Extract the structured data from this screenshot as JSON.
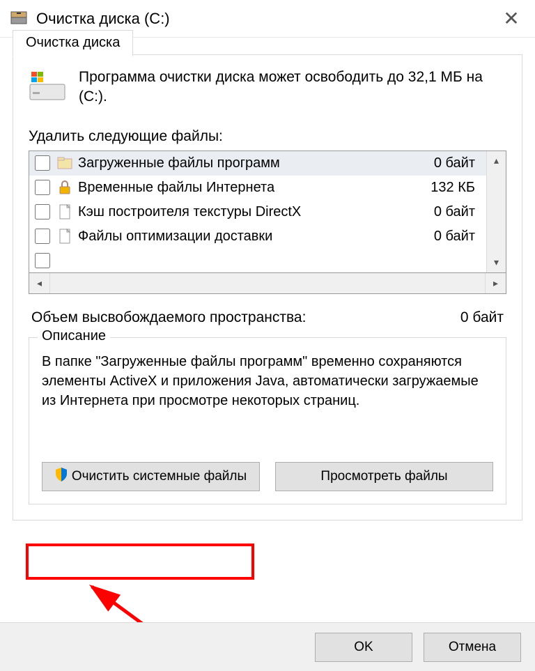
{
  "window": {
    "title": "Очистка диска  (C:)"
  },
  "tab": {
    "label": "Очистка диска"
  },
  "info": {
    "text": "Программа очистки диска может освободить до 32,1 МБ на  (С:)."
  },
  "list": {
    "label": "Удалить следующие файлы:",
    "items": [
      {
        "name": "Загруженные файлы программ",
        "size": "0 байт",
        "icon": "folder",
        "selected": true
      },
      {
        "name": "Временные файлы Интернета",
        "size": "132 КБ",
        "icon": "lock",
        "selected": false
      },
      {
        "name": "Кэш построителя текстуры DirectX",
        "size": "0 байт",
        "icon": "file",
        "selected": false
      },
      {
        "name": "Файлы оптимизации доставки",
        "size": "0 байт",
        "icon": "file",
        "selected": false
      }
    ]
  },
  "summary": {
    "label": "Объем высвобождаемого пространства:",
    "value": "0 байт"
  },
  "description": {
    "title": "Описание",
    "body": "В папке \"Загруженные файлы программ\" временно сохраняются элементы ActiveX и приложения Java, автоматически загружаемые из Интернета при просмотре некоторых страниц."
  },
  "buttons": {
    "cleanup_system": "Очистить системные файлы",
    "view_files": "Просмотреть файлы",
    "ok": "OK",
    "cancel": "Отмена"
  }
}
